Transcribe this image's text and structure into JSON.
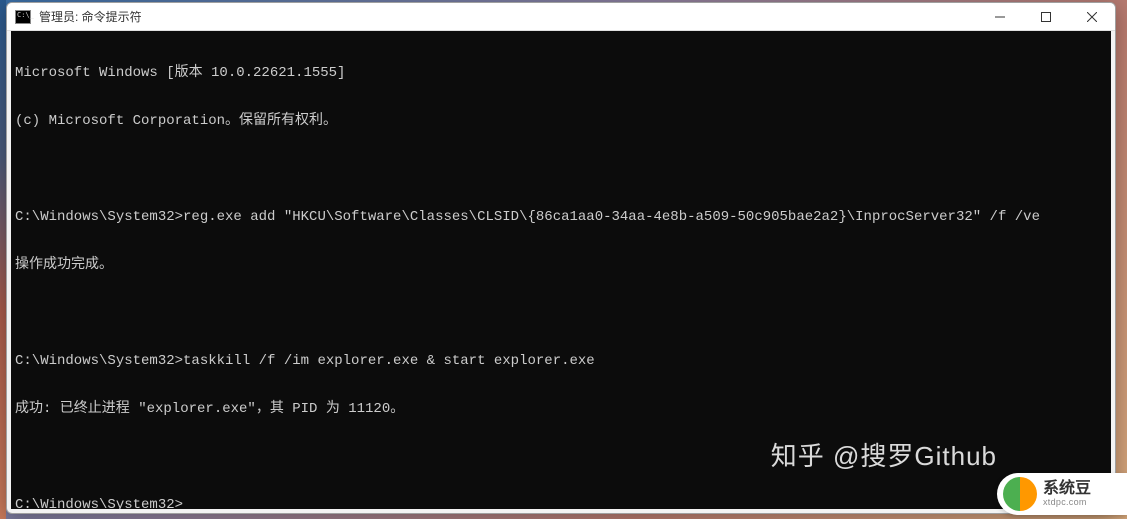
{
  "window": {
    "title": "管理员: 命令提示符"
  },
  "terminal": {
    "lines": [
      "Microsoft Windows [版本 10.0.22621.1555]",
      "(c) Microsoft Corporation。保留所有权利。",
      "",
      "C:\\Windows\\System32>reg.exe add \"HKCU\\Software\\Classes\\CLSID\\{86ca1aa0-34aa-4e8b-a509-50c905bae2a2}\\InprocServer32\" /f /ve",
      "操作成功完成。",
      "",
      "C:\\Windows\\System32>taskkill /f /im explorer.exe & start explorer.exe",
      "成功: 已终止进程 \"explorer.exe\"，其 PID 为 11120。",
      ""
    ],
    "current_prompt": "C:\\Windows\\System32>"
  },
  "watermark": {
    "text": "知乎 @搜罗Github"
  },
  "badge": {
    "title": "系统豆",
    "subtitle": "xtdpc.com"
  }
}
